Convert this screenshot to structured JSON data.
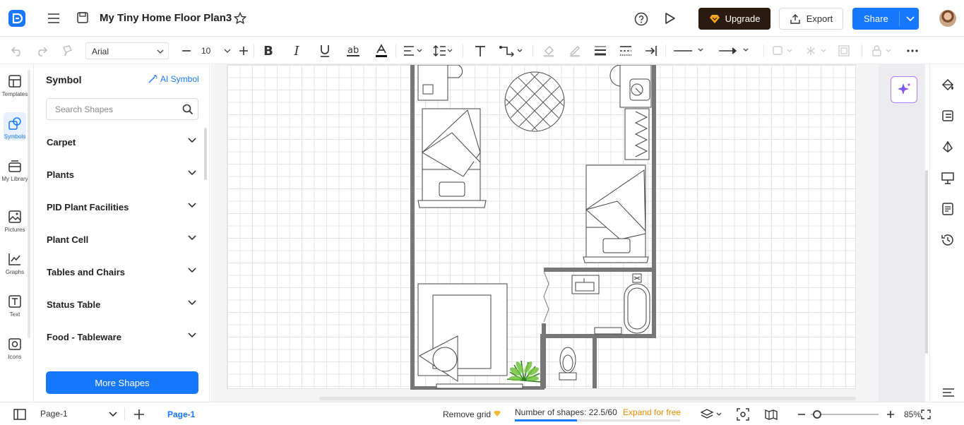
{
  "header": {
    "doc_title": "My Tiny Home Floor Plan3",
    "upgrade_label": "Upgrade",
    "export_label": "Export",
    "share_label": "Share"
  },
  "toolbar": {
    "font_family": "Arial",
    "font_size": "10"
  },
  "rail": [
    {
      "label": "Templates",
      "icon": "templates-icon"
    },
    {
      "label": "Symbols",
      "icon": "symbols-icon",
      "active": true
    },
    {
      "label": "My Library",
      "icon": "library-icon"
    },
    {
      "label": "Pictures",
      "icon": "pictures-icon"
    },
    {
      "label": "Graphs",
      "icon": "graphs-icon"
    },
    {
      "label": "Text",
      "icon": "text-icon"
    },
    {
      "label": "Icons",
      "icon": "icons-icon"
    }
  ],
  "panel": {
    "title": "Symbol",
    "ai_symbol": "AI Symbol",
    "search_placeholder": "Search Shapes",
    "categories": [
      "Carpet",
      "Plants",
      "PID Plant Facilities",
      "Plant Cell",
      "Tables and Chairs",
      "Status Table",
      "Food - Tableware"
    ],
    "more_shapes": "More Shapes"
  },
  "status": {
    "page_selector": "Page-1",
    "active_page": "Page-1",
    "remove_grid": "Remove grid",
    "shapes_count": "Number of shapes: 22.5/60",
    "shapes_fraction": 0.375,
    "expand": "Expand for free",
    "zoom": "85%"
  },
  "colors": {
    "accent": "#1677ff",
    "upgrade_bg": "#2b1a10",
    "expand": "#f08a00",
    "ai_border": "#b67cf2"
  }
}
